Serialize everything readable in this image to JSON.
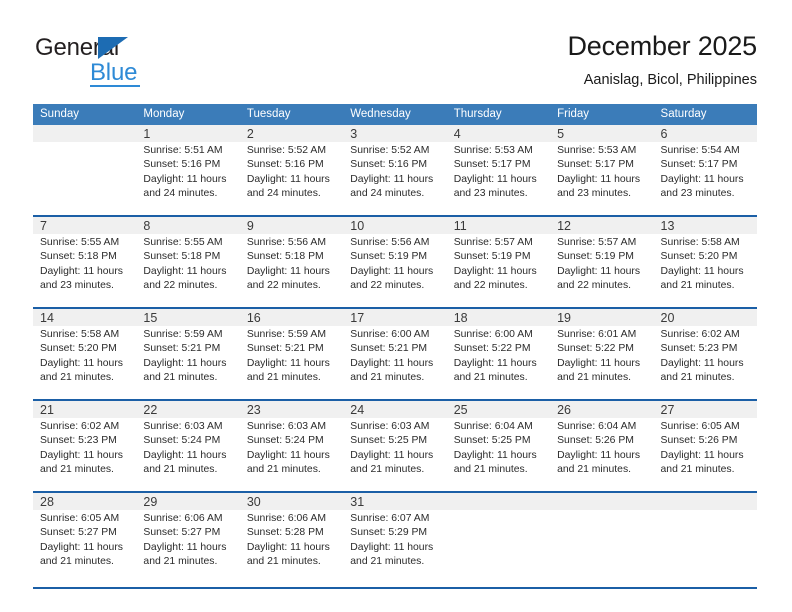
{
  "brand": {
    "name_top": "General",
    "name_bottom": "Blue",
    "triangle_color": "#1d6cb3",
    "blue_color": "#2e8ad6",
    "dark_color": "#231f20"
  },
  "header": {
    "title": "December 2025",
    "subtitle": "Aanislag, Bicol, Philippines"
  },
  "colors": {
    "header_bar": "#3b7cb9",
    "daynum_band": "#f0f0f0",
    "week_separator": "#1b5fa6",
    "text": "#2b2b2b"
  },
  "weekday_headers": [
    "Sunday",
    "Monday",
    "Tuesday",
    "Wednesday",
    "Thursday",
    "Friday",
    "Saturday"
  ],
  "labels": {
    "sunrise_prefix": "Sunrise:",
    "sunset_prefix": "Sunset:",
    "daylight_prefix": "Daylight:"
  },
  "weeks": [
    {
      "days": [
        {
          "num": "",
          "sunrise": "",
          "sunset": "",
          "daylight_line1": "",
          "daylight_line2": ""
        },
        {
          "num": "1",
          "sunrise": "Sunrise: 5:51 AM",
          "sunset": "Sunset: 5:16 PM",
          "daylight_line1": "Daylight: 11 hours",
          "daylight_line2": "and 24 minutes."
        },
        {
          "num": "2",
          "sunrise": "Sunrise: 5:52 AM",
          "sunset": "Sunset: 5:16 PM",
          "daylight_line1": "Daylight: 11 hours",
          "daylight_line2": "and 24 minutes."
        },
        {
          "num": "3",
          "sunrise": "Sunrise: 5:52 AM",
          "sunset": "Sunset: 5:16 PM",
          "daylight_line1": "Daylight: 11 hours",
          "daylight_line2": "and 24 minutes."
        },
        {
          "num": "4",
          "sunrise": "Sunrise: 5:53 AM",
          "sunset": "Sunset: 5:17 PM",
          "daylight_line1": "Daylight: 11 hours",
          "daylight_line2": "and 23 minutes."
        },
        {
          "num": "5",
          "sunrise": "Sunrise: 5:53 AM",
          "sunset": "Sunset: 5:17 PM",
          "daylight_line1": "Daylight: 11 hours",
          "daylight_line2": "and 23 minutes."
        },
        {
          "num": "6",
          "sunrise": "Sunrise: 5:54 AM",
          "sunset": "Sunset: 5:17 PM",
          "daylight_line1": "Daylight: 11 hours",
          "daylight_line2": "and 23 minutes."
        }
      ]
    },
    {
      "days": [
        {
          "num": "7",
          "sunrise": "Sunrise: 5:55 AM",
          "sunset": "Sunset: 5:18 PM",
          "daylight_line1": "Daylight: 11 hours",
          "daylight_line2": "and 23 minutes."
        },
        {
          "num": "8",
          "sunrise": "Sunrise: 5:55 AM",
          "sunset": "Sunset: 5:18 PM",
          "daylight_line1": "Daylight: 11 hours",
          "daylight_line2": "and 22 minutes."
        },
        {
          "num": "9",
          "sunrise": "Sunrise: 5:56 AM",
          "sunset": "Sunset: 5:18 PM",
          "daylight_line1": "Daylight: 11 hours",
          "daylight_line2": "and 22 minutes."
        },
        {
          "num": "10",
          "sunrise": "Sunrise: 5:56 AM",
          "sunset": "Sunset: 5:19 PM",
          "daylight_line1": "Daylight: 11 hours",
          "daylight_line2": "and 22 minutes."
        },
        {
          "num": "11",
          "sunrise": "Sunrise: 5:57 AM",
          "sunset": "Sunset: 5:19 PM",
          "daylight_line1": "Daylight: 11 hours",
          "daylight_line2": "and 22 minutes."
        },
        {
          "num": "12",
          "sunrise": "Sunrise: 5:57 AM",
          "sunset": "Sunset: 5:19 PM",
          "daylight_line1": "Daylight: 11 hours",
          "daylight_line2": "and 22 minutes."
        },
        {
          "num": "13",
          "sunrise": "Sunrise: 5:58 AM",
          "sunset": "Sunset: 5:20 PM",
          "daylight_line1": "Daylight: 11 hours",
          "daylight_line2": "and 21 minutes."
        }
      ]
    },
    {
      "days": [
        {
          "num": "14",
          "sunrise": "Sunrise: 5:58 AM",
          "sunset": "Sunset: 5:20 PM",
          "daylight_line1": "Daylight: 11 hours",
          "daylight_line2": "and 21 minutes."
        },
        {
          "num": "15",
          "sunrise": "Sunrise: 5:59 AM",
          "sunset": "Sunset: 5:21 PM",
          "daylight_line1": "Daylight: 11 hours",
          "daylight_line2": "and 21 minutes."
        },
        {
          "num": "16",
          "sunrise": "Sunrise: 5:59 AM",
          "sunset": "Sunset: 5:21 PM",
          "daylight_line1": "Daylight: 11 hours",
          "daylight_line2": "and 21 minutes."
        },
        {
          "num": "17",
          "sunrise": "Sunrise: 6:00 AM",
          "sunset": "Sunset: 5:21 PM",
          "daylight_line1": "Daylight: 11 hours",
          "daylight_line2": "and 21 minutes."
        },
        {
          "num": "18",
          "sunrise": "Sunrise: 6:00 AM",
          "sunset": "Sunset: 5:22 PM",
          "daylight_line1": "Daylight: 11 hours",
          "daylight_line2": "and 21 minutes."
        },
        {
          "num": "19",
          "sunrise": "Sunrise: 6:01 AM",
          "sunset": "Sunset: 5:22 PM",
          "daylight_line1": "Daylight: 11 hours",
          "daylight_line2": "and 21 minutes."
        },
        {
          "num": "20",
          "sunrise": "Sunrise: 6:02 AM",
          "sunset": "Sunset: 5:23 PM",
          "daylight_line1": "Daylight: 11 hours",
          "daylight_line2": "and 21 minutes."
        }
      ]
    },
    {
      "days": [
        {
          "num": "21",
          "sunrise": "Sunrise: 6:02 AM",
          "sunset": "Sunset: 5:23 PM",
          "daylight_line1": "Daylight: 11 hours",
          "daylight_line2": "and 21 minutes."
        },
        {
          "num": "22",
          "sunrise": "Sunrise: 6:03 AM",
          "sunset": "Sunset: 5:24 PM",
          "daylight_line1": "Daylight: 11 hours",
          "daylight_line2": "and 21 minutes."
        },
        {
          "num": "23",
          "sunrise": "Sunrise: 6:03 AM",
          "sunset": "Sunset: 5:24 PM",
          "daylight_line1": "Daylight: 11 hours",
          "daylight_line2": "and 21 minutes."
        },
        {
          "num": "24",
          "sunrise": "Sunrise: 6:03 AM",
          "sunset": "Sunset: 5:25 PM",
          "daylight_line1": "Daylight: 11 hours",
          "daylight_line2": "and 21 minutes."
        },
        {
          "num": "25",
          "sunrise": "Sunrise: 6:04 AM",
          "sunset": "Sunset: 5:25 PM",
          "daylight_line1": "Daylight: 11 hours",
          "daylight_line2": "and 21 minutes."
        },
        {
          "num": "26",
          "sunrise": "Sunrise: 6:04 AM",
          "sunset": "Sunset: 5:26 PM",
          "daylight_line1": "Daylight: 11 hours",
          "daylight_line2": "and 21 minutes."
        },
        {
          "num": "27",
          "sunrise": "Sunrise: 6:05 AM",
          "sunset": "Sunset: 5:26 PM",
          "daylight_line1": "Daylight: 11 hours",
          "daylight_line2": "and 21 minutes."
        }
      ]
    },
    {
      "days": [
        {
          "num": "28",
          "sunrise": "Sunrise: 6:05 AM",
          "sunset": "Sunset: 5:27 PM",
          "daylight_line1": "Daylight: 11 hours",
          "daylight_line2": "and 21 minutes."
        },
        {
          "num": "29",
          "sunrise": "Sunrise: 6:06 AM",
          "sunset": "Sunset: 5:27 PM",
          "daylight_line1": "Daylight: 11 hours",
          "daylight_line2": "and 21 minutes."
        },
        {
          "num": "30",
          "sunrise": "Sunrise: 6:06 AM",
          "sunset": "Sunset: 5:28 PM",
          "daylight_line1": "Daylight: 11 hours",
          "daylight_line2": "and 21 minutes."
        },
        {
          "num": "31",
          "sunrise": "Sunrise: 6:07 AM",
          "sunset": "Sunset: 5:29 PM",
          "daylight_line1": "Daylight: 11 hours",
          "daylight_line2": "and 21 minutes."
        },
        {
          "num": "",
          "sunrise": "",
          "sunset": "",
          "daylight_line1": "",
          "daylight_line2": ""
        },
        {
          "num": "",
          "sunrise": "",
          "sunset": "",
          "daylight_line1": "",
          "daylight_line2": ""
        },
        {
          "num": "",
          "sunrise": "",
          "sunset": "",
          "daylight_line1": "",
          "daylight_line2": ""
        }
      ]
    }
  ]
}
